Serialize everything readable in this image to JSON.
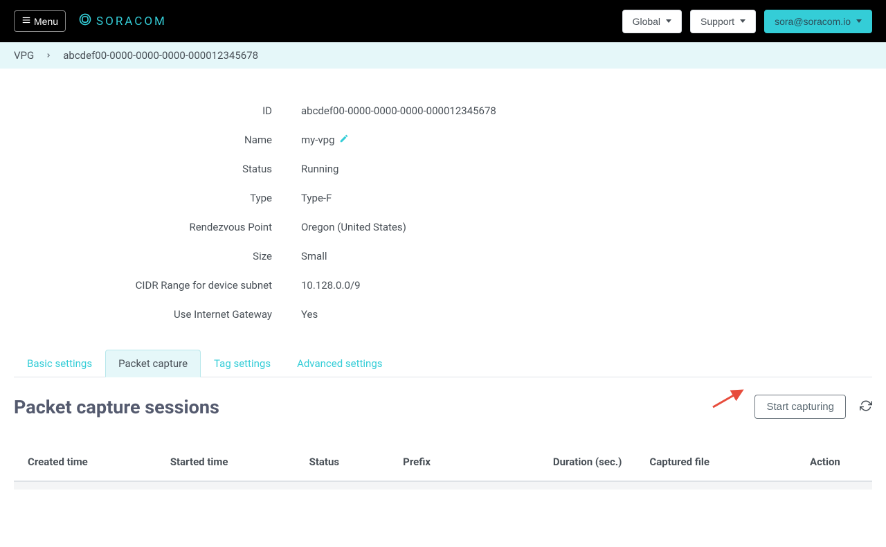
{
  "nav": {
    "menu_label": "Menu",
    "brand_text": "SORACOM",
    "global_label": "Global",
    "support_label": "Support",
    "user_email": "sora@soracom.io"
  },
  "breadcrumb": {
    "root": "VPG",
    "current": "abcdef00-0000-0000-0000-000012345678"
  },
  "details": {
    "id_label": "ID",
    "id_value": "abcdef00-0000-0000-0000-000012345678",
    "name_label": "Name",
    "name_value": "my-vpg",
    "status_label": "Status",
    "status_value": "Running",
    "type_label": "Type",
    "type_value": "Type-F",
    "rendezvous_label": "Rendezvous Point",
    "rendezvous_value": "Oregon (United States)",
    "size_label": "Size",
    "size_value": "Small",
    "cidr_label": "CIDR Range for device subnet",
    "cidr_value": "10.128.0.0/9",
    "igw_label": "Use Internet Gateway",
    "igw_value": "Yes"
  },
  "tabs": {
    "basic": "Basic settings",
    "packet": "Packet capture",
    "tag": "Tag settings",
    "advanced": "Advanced settings"
  },
  "section": {
    "title": "Packet capture sessions",
    "start_button": "Start capturing"
  },
  "table": {
    "col_created": "Created time",
    "col_started": "Started time",
    "col_status": "Status",
    "col_prefix": "Prefix",
    "col_duration": "Duration (sec.)",
    "col_file": "Captured file",
    "col_action": "Action"
  }
}
